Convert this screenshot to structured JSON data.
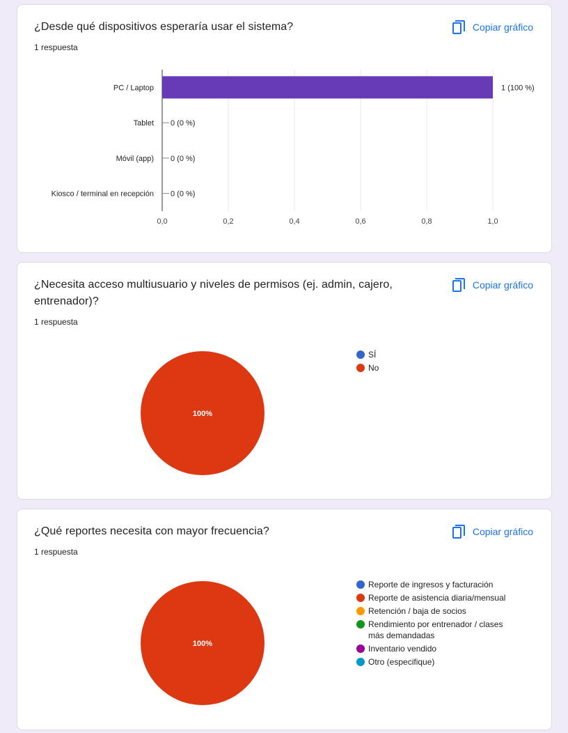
{
  "cards": [
    {
      "title": "¿Desde qué dispositivos esperaría usar el sistema?",
      "responses": "1 respuesta",
      "copy_label": "Copiar gráfico"
    },
    {
      "title": "¿Necesita acceso multiusuario y niveles de permisos (ej. admin, cajero, entrenador)?",
      "responses": "1 respuesta",
      "copy_label": "Copiar gráfico"
    },
    {
      "title": "¿Qué reportes necesita con mayor frecuencia?",
      "responses": "1 respuesta",
      "copy_label": "Copiar gráfico"
    }
  ],
  "icons": {
    "copy": "copy-icon"
  },
  "colors": {
    "accent": "#1a73e8",
    "bar": "#673ab7",
    "background": "#f0ebf8"
  },
  "chart_data": [
    {
      "type": "bar",
      "orientation": "horizontal",
      "categories": [
        "PC / Laptop",
        "Tablet",
        "Móvil (app)",
        "Kiosco / terminal en recepción"
      ],
      "values": [
        1,
        0,
        0,
        0
      ],
      "data_labels": [
        "1 (100 %)",
        "0 (0 %)",
        "0 (0 %)",
        "0 (0 %)"
      ],
      "xlim": [
        0,
        1
      ],
      "x_ticks": [
        "0,0",
        "0,2",
        "0,4",
        "0,6",
        "0,8",
        "1,0"
      ],
      "grid": true,
      "color": "#673ab7"
    },
    {
      "type": "pie",
      "categories": [
        "SÍ",
        "No"
      ],
      "values": [
        0,
        100
      ],
      "colors": [
        "#3366cc",
        "#dc3912"
      ],
      "slice_label": "100%",
      "legend": "right"
    },
    {
      "type": "pie",
      "categories": [
        "Reporte de ingresos y facturación",
        "Reporte de asistencia diaria/mensual",
        "Retención / baja de socios",
        "Rendimiento por entrenador / clases más demandadas",
        "Inventario vendido",
        "Otro (especifique)"
      ],
      "values": [
        0,
        100,
        0,
        0,
        0,
        0
      ],
      "colors": [
        "#3366cc",
        "#dc3912",
        "#ff9900",
        "#109618",
        "#990099",
        "#0099c6"
      ],
      "slice_label": "100%",
      "legend": "right"
    }
  ]
}
